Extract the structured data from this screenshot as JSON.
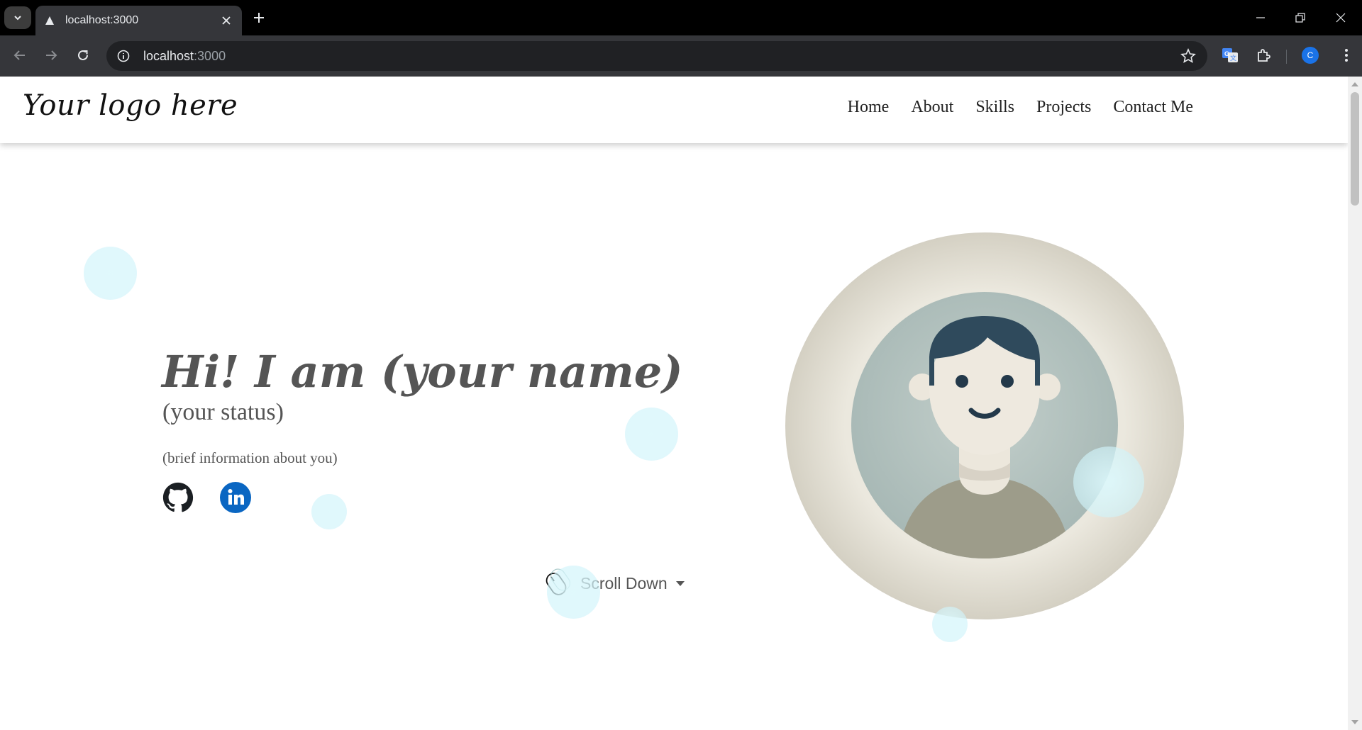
{
  "browser": {
    "tab_title": "localhost:3000",
    "url_host": "localhost",
    "url_port": ":3000",
    "profile_initial": "C"
  },
  "header": {
    "logo_text": "Your logo here",
    "nav": [
      "Home",
      "About",
      "Skills",
      "Projects",
      "Contact Me"
    ]
  },
  "hero": {
    "title": "Hi! I am (your name)",
    "status": "(your status)",
    "brief": "(brief information about you)",
    "social_icons": [
      "github-icon",
      "linkedin-icon"
    ],
    "scroll_label": "Scroll Down"
  },
  "colors": {
    "text_gray": "#555555",
    "linkedin_blue": "#0a66c2",
    "avatar_ring": "#d6d3c6",
    "avatar_bg": "#aebfbc",
    "hair": "#2f4a5c",
    "shirt": "#9d9c8a"
  }
}
